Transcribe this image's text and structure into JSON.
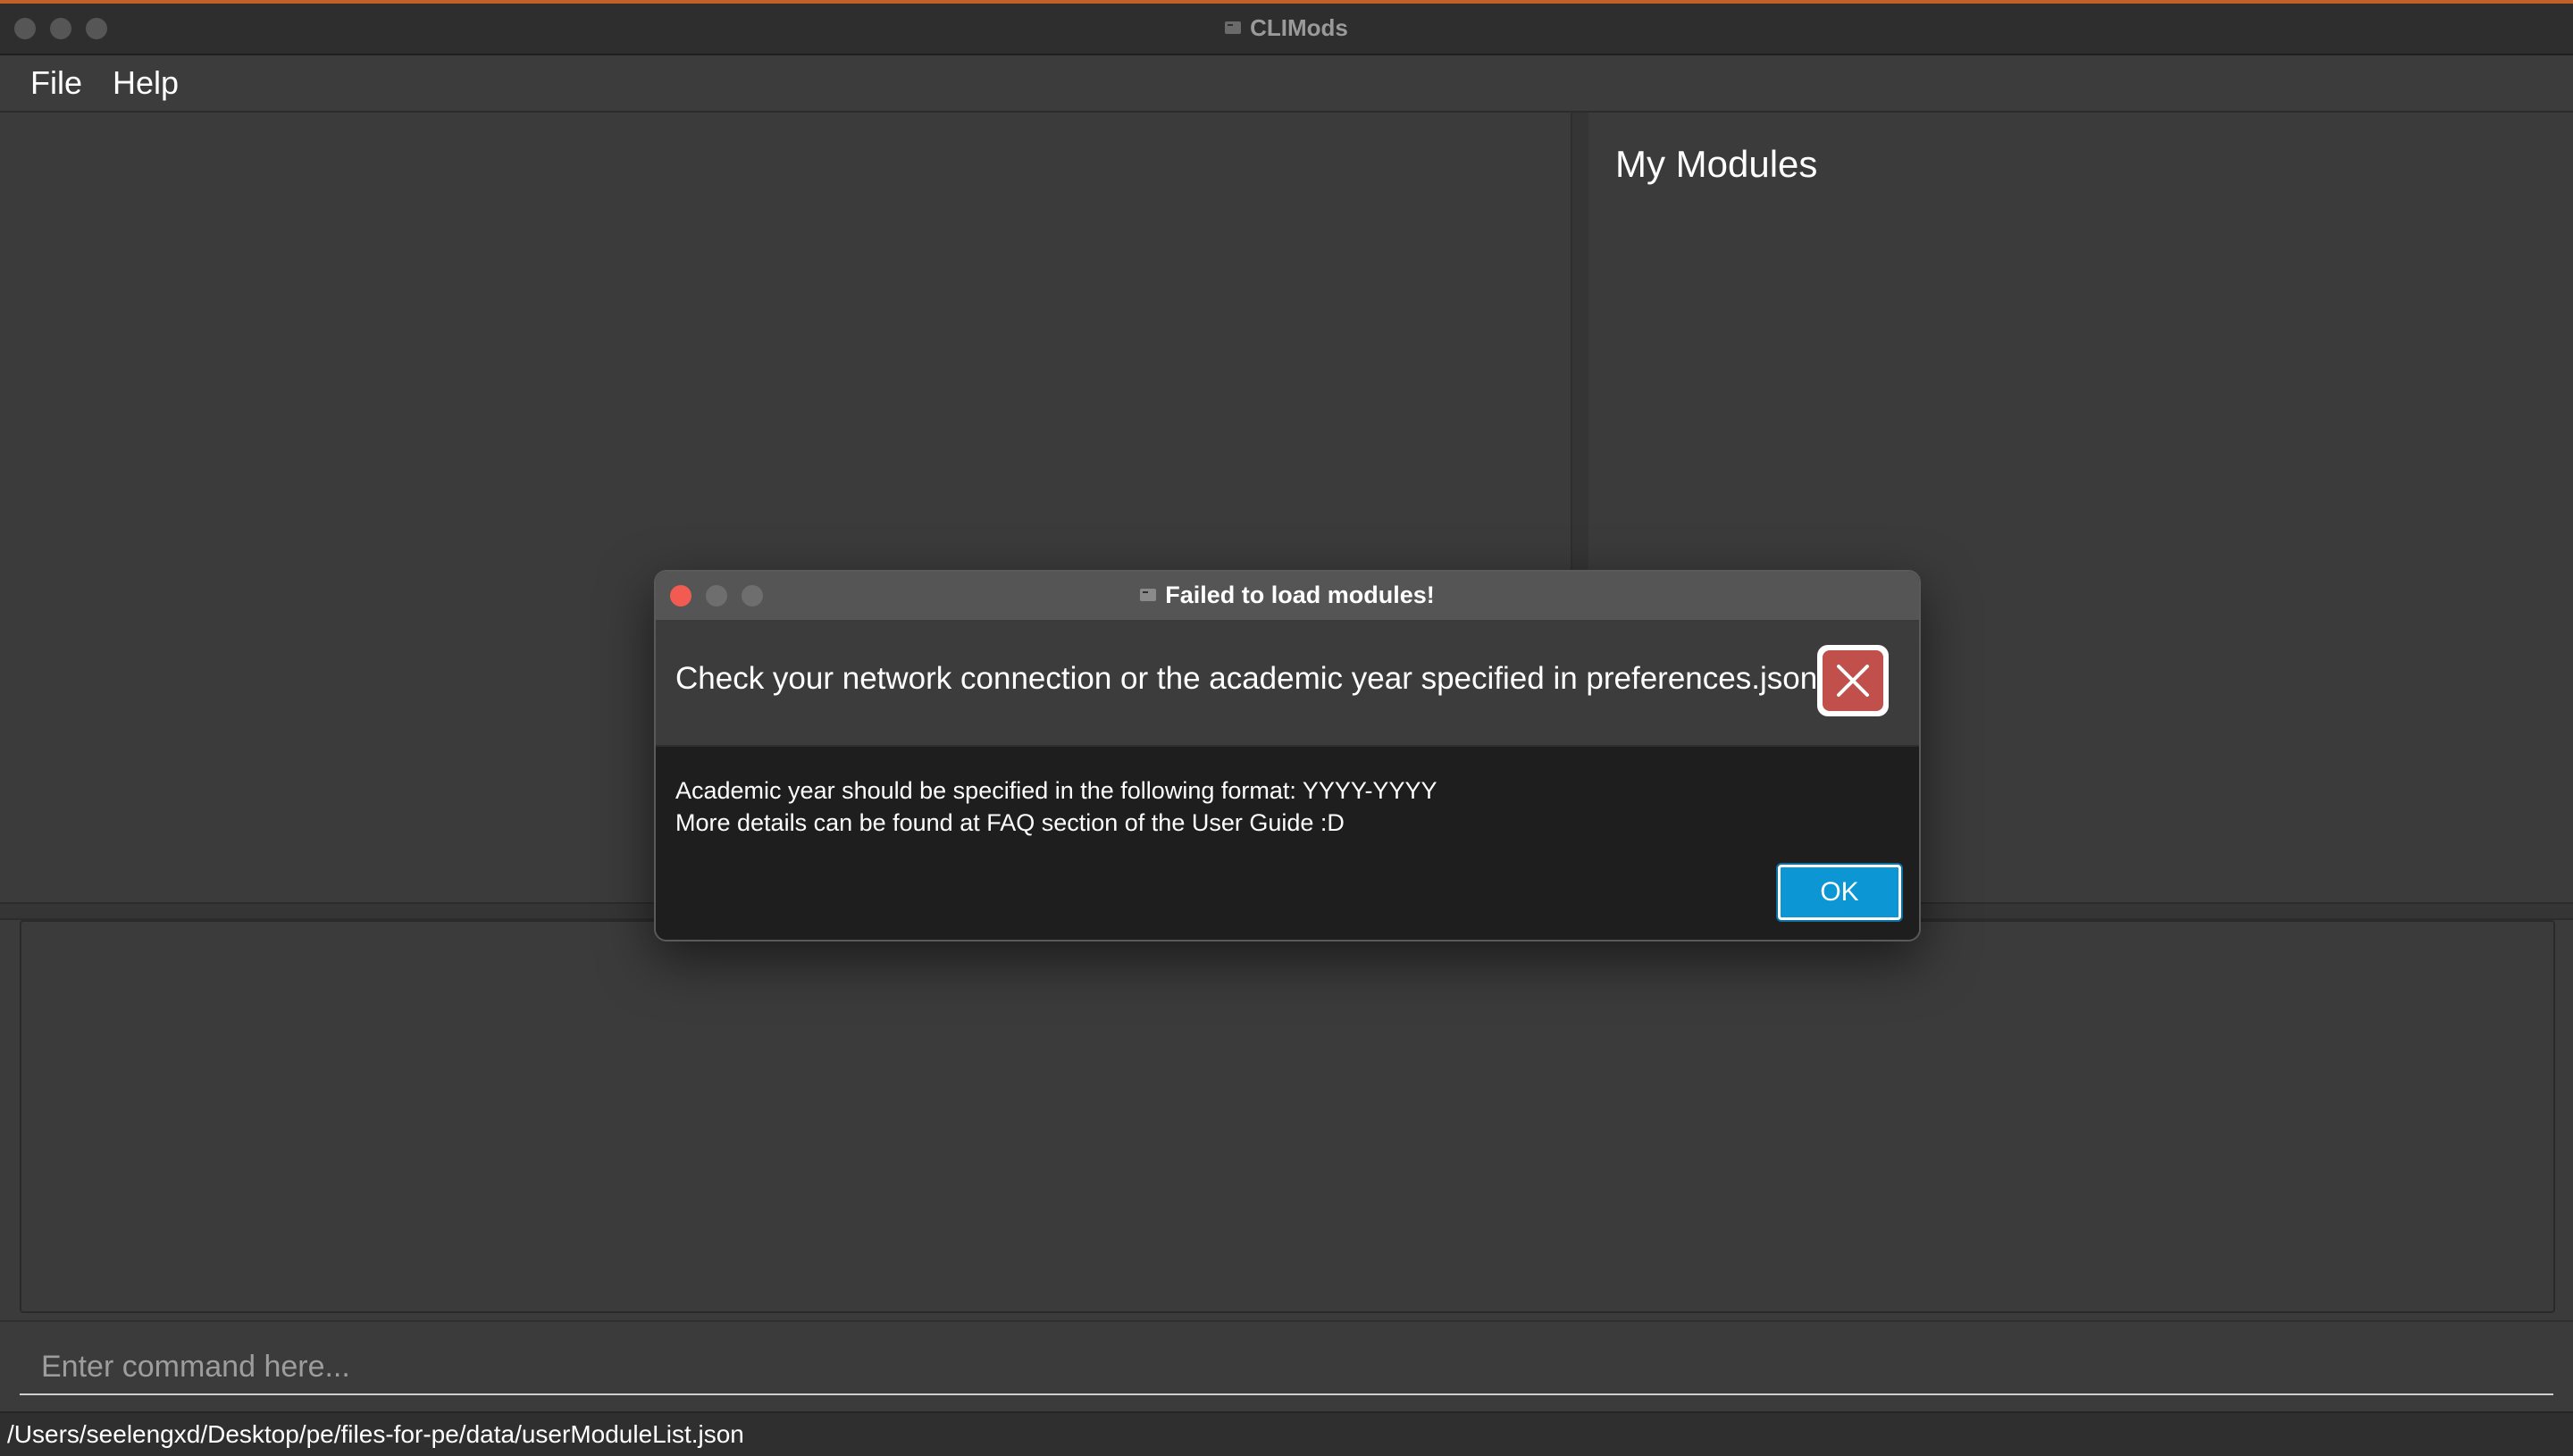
{
  "window": {
    "title": "CLIMods"
  },
  "menu": {
    "items": [
      "File",
      "Help"
    ]
  },
  "right_panel": {
    "heading": "My Modules"
  },
  "command": {
    "placeholder": "Enter command here..."
  },
  "status": {
    "path": "/Users/seelengxd/Desktop/pe/files-for-pe/data/userModuleList.json"
  },
  "dialog": {
    "title": "Failed to load modules!",
    "headline": "Check your network connection or the academic year specified in preferences.json",
    "body_lines": [
      "Academic year should be specified in the following format: YYYY-YYYY",
      "More details can be found at FAQ section of the User Guide :D"
    ],
    "ok_label": "OK",
    "icon": "error-x-icon"
  },
  "colors": {
    "ok_button": "#0d96d4",
    "error_icon": "#c14f4b",
    "close_traffic_light": "#f15b52"
  }
}
